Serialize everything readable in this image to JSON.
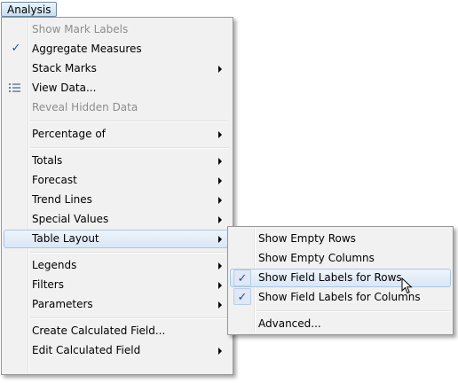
{
  "menubar": {
    "analysis_label": "Analysis"
  },
  "main_menu": {
    "items": [
      {
        "label": "Show Mark Labels"
      },
      {
        "label": "Aggregate Measures"
      },
      {
        "label": "Stack Marks"
      },
      {
        "label": "View Data..."
      },
      {
        "label": "Reveal Hidden Data"
      },
      {
        "label": "Percentage of"
      },
      {
        "label": "Totals"
      },
      {
        "label": "Forecast"
      },
      {
        "label": "Trend Lines"
      },
      {
        "label": "Special Values"
      },
      {
        "label": "Table Layout"
      },
      {
        "label": "Legends"
      },
      {
        "label": "Filters"
      },
      {
        "label": "Parameters"
      },
      {
        "label": "Create Calculated Field..."
      },
      {
        "label": "Edit Calculated Field"
      }
    ]
  },
  "submenu": {
    "items": [
      {
        "label": "Show Empty Rows"
      },
      {
        "label": "Show Empty Columns"
      },
      {
        "label": "Show Field Labels for Rows"
      },
      {
        "label": "Show Field Labels for Columns"
      },
      {
        "label": "Advanced..."
      }
    ]
  },
  "icons": {
    "checkmark": "✓"
  }
}
